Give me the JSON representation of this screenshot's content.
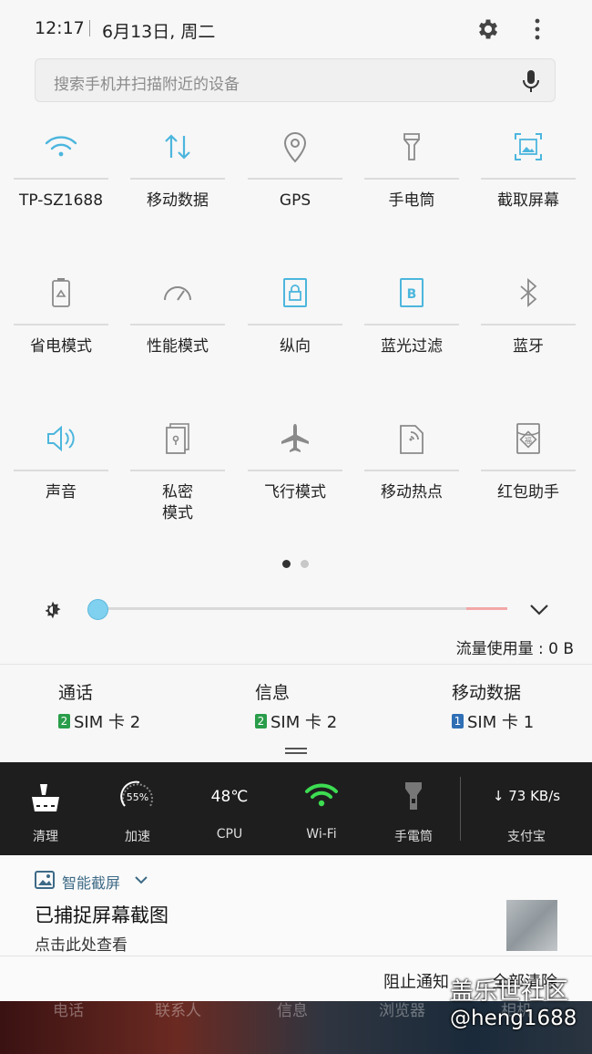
{
  "status": {
    "time": "12:17",
    "date": "6月13日, 周二"
  },
  "search": {
    "placeholder": "搜索手机并扫描附近的设备"
  },
  "toggles": [
    {
      "label": "TP-SZ1688",
      "icon": "wifi-icon",
      "active": true
    },
    {
      "label": "移动数据",
      "icon": "mobile-data-icon",
      "active": true
    },
    {
      "label": "GPS",
      "icon": "location-icon",
      "active": false
    },
    {
      "label": "手电筒",
      "icon": "flashlight-icon",
      "active": false
    },
    {
      "label": "截取屏幕",
      "icon": "screenshot-icon",
      "active": true
    },
    {
      "label": "省电模式",
      "icon": "battery-saver-icon",
      "active": false
    },
    {
      "label": "性能模式",
      "icon": "performance-icon",
      "active": false
    },
    {
      "label": "纵向",
      "icon": "portrait-lock-icon",
      "active": true
    },
    {
      "label": "蓝光过滤",
      "icon": "blue-light-filter-icon",
      "active": true
    },
    {
      "label": "蓝牙",
      "icon": "bluetooth-icon",
      "active": false
    },
    {
      "label": "声音",
      "icon": "sound-icon",
      "active": true
    },
    {
      "label": "私密\n模式",
      "icon": "private-mode-icon",
      "active": false
    },
    {
      "label": "飞行模式",
      "icon": "airplane-icon",
      "active": false
    },
    {
      "label": "移动热点",
      "icon": "hotspot-icon",
      "active": false
    },
    {
      "label": "红包助手",
      "icon": "red-envelope-icon",
      "active": false
    }
  ],
  "pager": {
    "current": 1,
    "total": 2
  },
  "brightness": {
    "level": 0.02
  },
  "data_usage": "流量使用量 : 0 B",
  "sim": [
    {
      "title": "通话",
      "slot": "2",
      "card": "SIM 卡 2",
      "color": "#2a9d4a"
    },
    {
      "title": "信息",
      "slot": "2",
      "card": "SIM 卡 2",
      "color": "#2a9d4a"
    },
    {
      "title": "移动数据",
      "slot": "1",
      "card": "SIM 卡 1",
      "color": "#2f6fb5"
    }
  ],
  "shortcuts": [
    {
      "label": "清理",
      "icon": "broom-icon"
    },
    {
      "label": "加速",
      "icon": "speed-gauge-icon",
      "value": "55%"
    },
    {
      "label": "CPU",
      "icon": "cpu-temp",
      "value": "48℃"
    },
    {
      "label": "Wi-Fi",
      "icon": "wifi-icon"
    },
    {
      "label": "手電筒",
      "icon": "flashlight-icon"
    },
    {
      "label": "支付宝",
      "icon": "download-speed",
      "value": "↓ 73 KB/s"
    }
  ],
  "notification": {
    "app": "智能截屏",
    "title": "已捕捉屏幕截图",
    "subtitle": "点击此处查看",
    "block": "阻止通知",
    "clear": "全部清除"
  },
  "dock": [
    "电话",
    "联系人",
    "信息",
    "浏览器",
    "相机"
  ],
  "watermark": {
    "line1": "盖乐世社区",
    "line2": "@heng1688"
  },
  "colors": {
    "accent": "#4cb6dd",
    "inactive": "#8a8a8a",
    "wifi_green": "#3ddc52"
  }
}
